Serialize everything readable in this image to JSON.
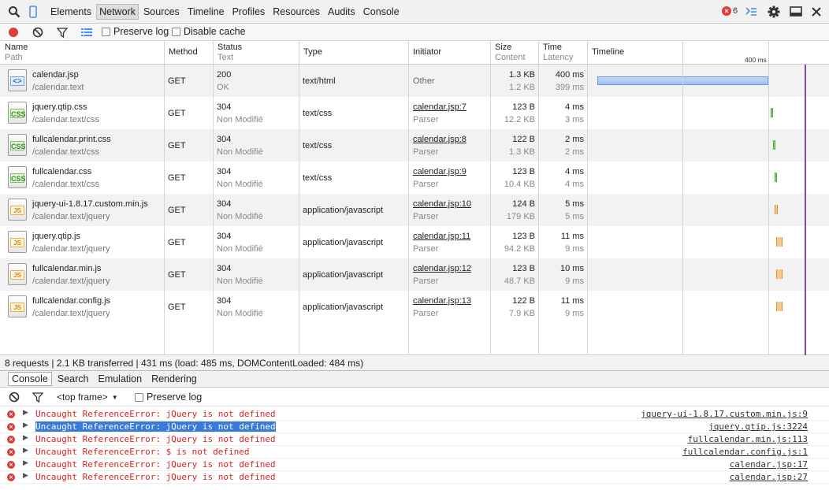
{
  "toolbar": {
    "tabs": [
      "Elements",
      "Network",
      "Sources",
      "Timeline",
      "Profiles",
      "Resources",
      "Audits",
      "Console"
    ],
    "active_tab": "Network",
    "error_count": "6"
  },
  "network_toolbar": {
    "preserve_log": "Preserve log",
    "disable_cache": "Disable cache"
  },
  "columns": {
    "name": "Name",
    "path": "Path",
    "method": "Method",
    "status": "Status",
    "text": "Text",
    "type": "Type",
    "initiator": "Initiator",
    "size": "Size",
    "content": "Content",
    "time": "Time",
    "latency": "Latency",
    "timeline": "Timeline",
    "timeline_mark": "400 ms"
  },
  "requests": [
    {
      "name": "calendar.jsp",
      "path": "/calendar.text",
      "method": "GET",
      "status": "200",
      "status_text": "OK",
      "type": "text/html",
      "initiator": "Other",
      "initiator_sub": "",
      "size": "1.3 KB",
      "content": "1.2 KB",
      "time": "400 ms",
      "latency": "399 ms",
      "icon": "doc",
      "icon_label": "<>"
    },
    {
      "name": "jquery.qtip.css",
      "path": "/calendar.text/css",
      "method": "GET",
      "status": "304",
      "status_text": "Non Modifié",
      "type": "text/css",
      "initiator": "calendar.jsp:7",
      "initiator_sub": "Parser",
      "size": "123 B",
      "content": "12.2 KB",
      "time": "4 ms",
      "latency": "3 ms",
      "icon": "css",
      "icon_label": "CSS"
    },
    {
      "name": "fullcalendar.print.css",
      "path": "/calendar.text/css",
      "method": "GET",
      "status": "304",
      "status_text": "Non Modifié",
      "type": "text/css",
      "initiator": "calendar.jsp:8",
      "initiator_sub": "Parser",
      "size": "122 B",
      "content": "1.3 KB",
      "time": "2 ms",
      "latency": "2 ms",
      "icon": "css",
      "icon_label": "CSS"
    },
    {
      "name": "fullcalendar.css",
      "path": "/calendar.text/css",
      "method": "GET",
      "status": "304",
      "status_text": "Non Modifié",
      "type": "text/css",
      "initiator": "calendar.jsp:9",
      "initiator_sub": "Parser",
      "size": "123 B",
      "content": "10.4 KB",
      "time": "4 ms",
      "latency": "4 ms",
      "icon": "css",
      "icon_label": "CSS"
    },
    {
      "name": "jquery-ui-1.8.17.custom.min.js",
      "path": "/calendar.text/jquery",
      "method": "GET",
      "status": "304",
      "status_text": "Non Modifié",
      "type": "application/javascript",
      "initiator": "calendar.jsp:10",
      "initiator_sub": "Parser",
      "size": "124 B",
      "content": "179 KB",
      "time": "5 ms",
      "latency": "5 ms",
      "icon": "js",
      "icon_label": "JS"
    },
    {
      "name": "jquery.qtip.js",
      "path": "/calendar.text/jquery",
      "method": "GET",
      "status": "304",
      "status_text": "Non Modifié",
      "type": "application/javascript",
      "initiator": "calendar.jsp:11",
      "initiator_sub": "Parser",
      "size": "123 B",
      "content": "94.2 KB",
      "time": "11 ms",
      "latency": "9 ms",
      "icon": "js",
      "icon_label": "JS"
    },
    {
      "name": "fullcalendar.min.js",
      "path": "/calendar.text/jquery",
      "method": "GET",
      "status": "304",
      "status_text": "Non Modifié",
      "type": "application/javascript",
      "initiator": "calendar.jsp:12",
      "initiator_sub": "Parser",
      "size": "123 B",
      "content": "48.7 KB",
      "time": "10 ms",
      "latency": "9 ms",
      "icon": "js",
      "icon_label": "JS"
    },
    {
      "name": "fullcalendar.config.js",
      "path": "/calendar.text/jquery",
      "method": "GET",
      "status": "304",
      "status_text": "Non Modifié",
      "type": "application/javascript",
      "initiator": "calendar.jsp:13",
      "initiator_sub": "Parser",
      "size": "122 B",
      "content": "7.9 KB",
      "time": "11 ms",
      "latency": "9 ms",
      "icon": "js",
      "icon_label": "JS"
    }
  ],
  "status_bar": "8 requests | 2.1 KB transferred | 431 ms (load: 485 ms, DOMContentLoaded: 484 ms)",
  "drawer_tabs": [
    "Console",
    "Search",
    "Emulation",
    "Rendering"
  ],
  "console_toolbar": {
    "frame": "<top frame>",
    "preserve_log": "Preserve log"
  },
  "console_messages": [
    {
      "text": "Uncaught ReferenceError: jQuery is not defined",
      "source": "jquery-ui-1.8.17.custom.min.js:9",
      "selected": false
    },
    {
      "text": "Uncaught ReferenceError: jQuery is not defined",
      "source": "jquery.qtip.js:3224",
      "selected": true
    },
    {
      "text": "Uncaught ReferenceError: jQuery is not defined",
      "source": "fullcalendar.min.js:113",
      "selected": false
    },
    {
      "text": "Uncaught ReferenceError: $ is not defined",
      "source": "fullcalendar.config.js:1",
      "selected": false
    },
    {
      "text": "Uncaught ReferenceError: jQuery is not defined",
      "source": "calendar.jsp:17",
      "selected": false
    },
    {
      "text": "Uncaught ReferenceError: jQuery is not defined",
      "source": "calendar.jsp:27",
      "selected": false
    }
  ],
  "colors": {
    "error": "#e0201c",
    "selection": "#3879d9",
    "record": "#d93f3f",
    "timeline_marker": "#7e4ca3"
  }
}
